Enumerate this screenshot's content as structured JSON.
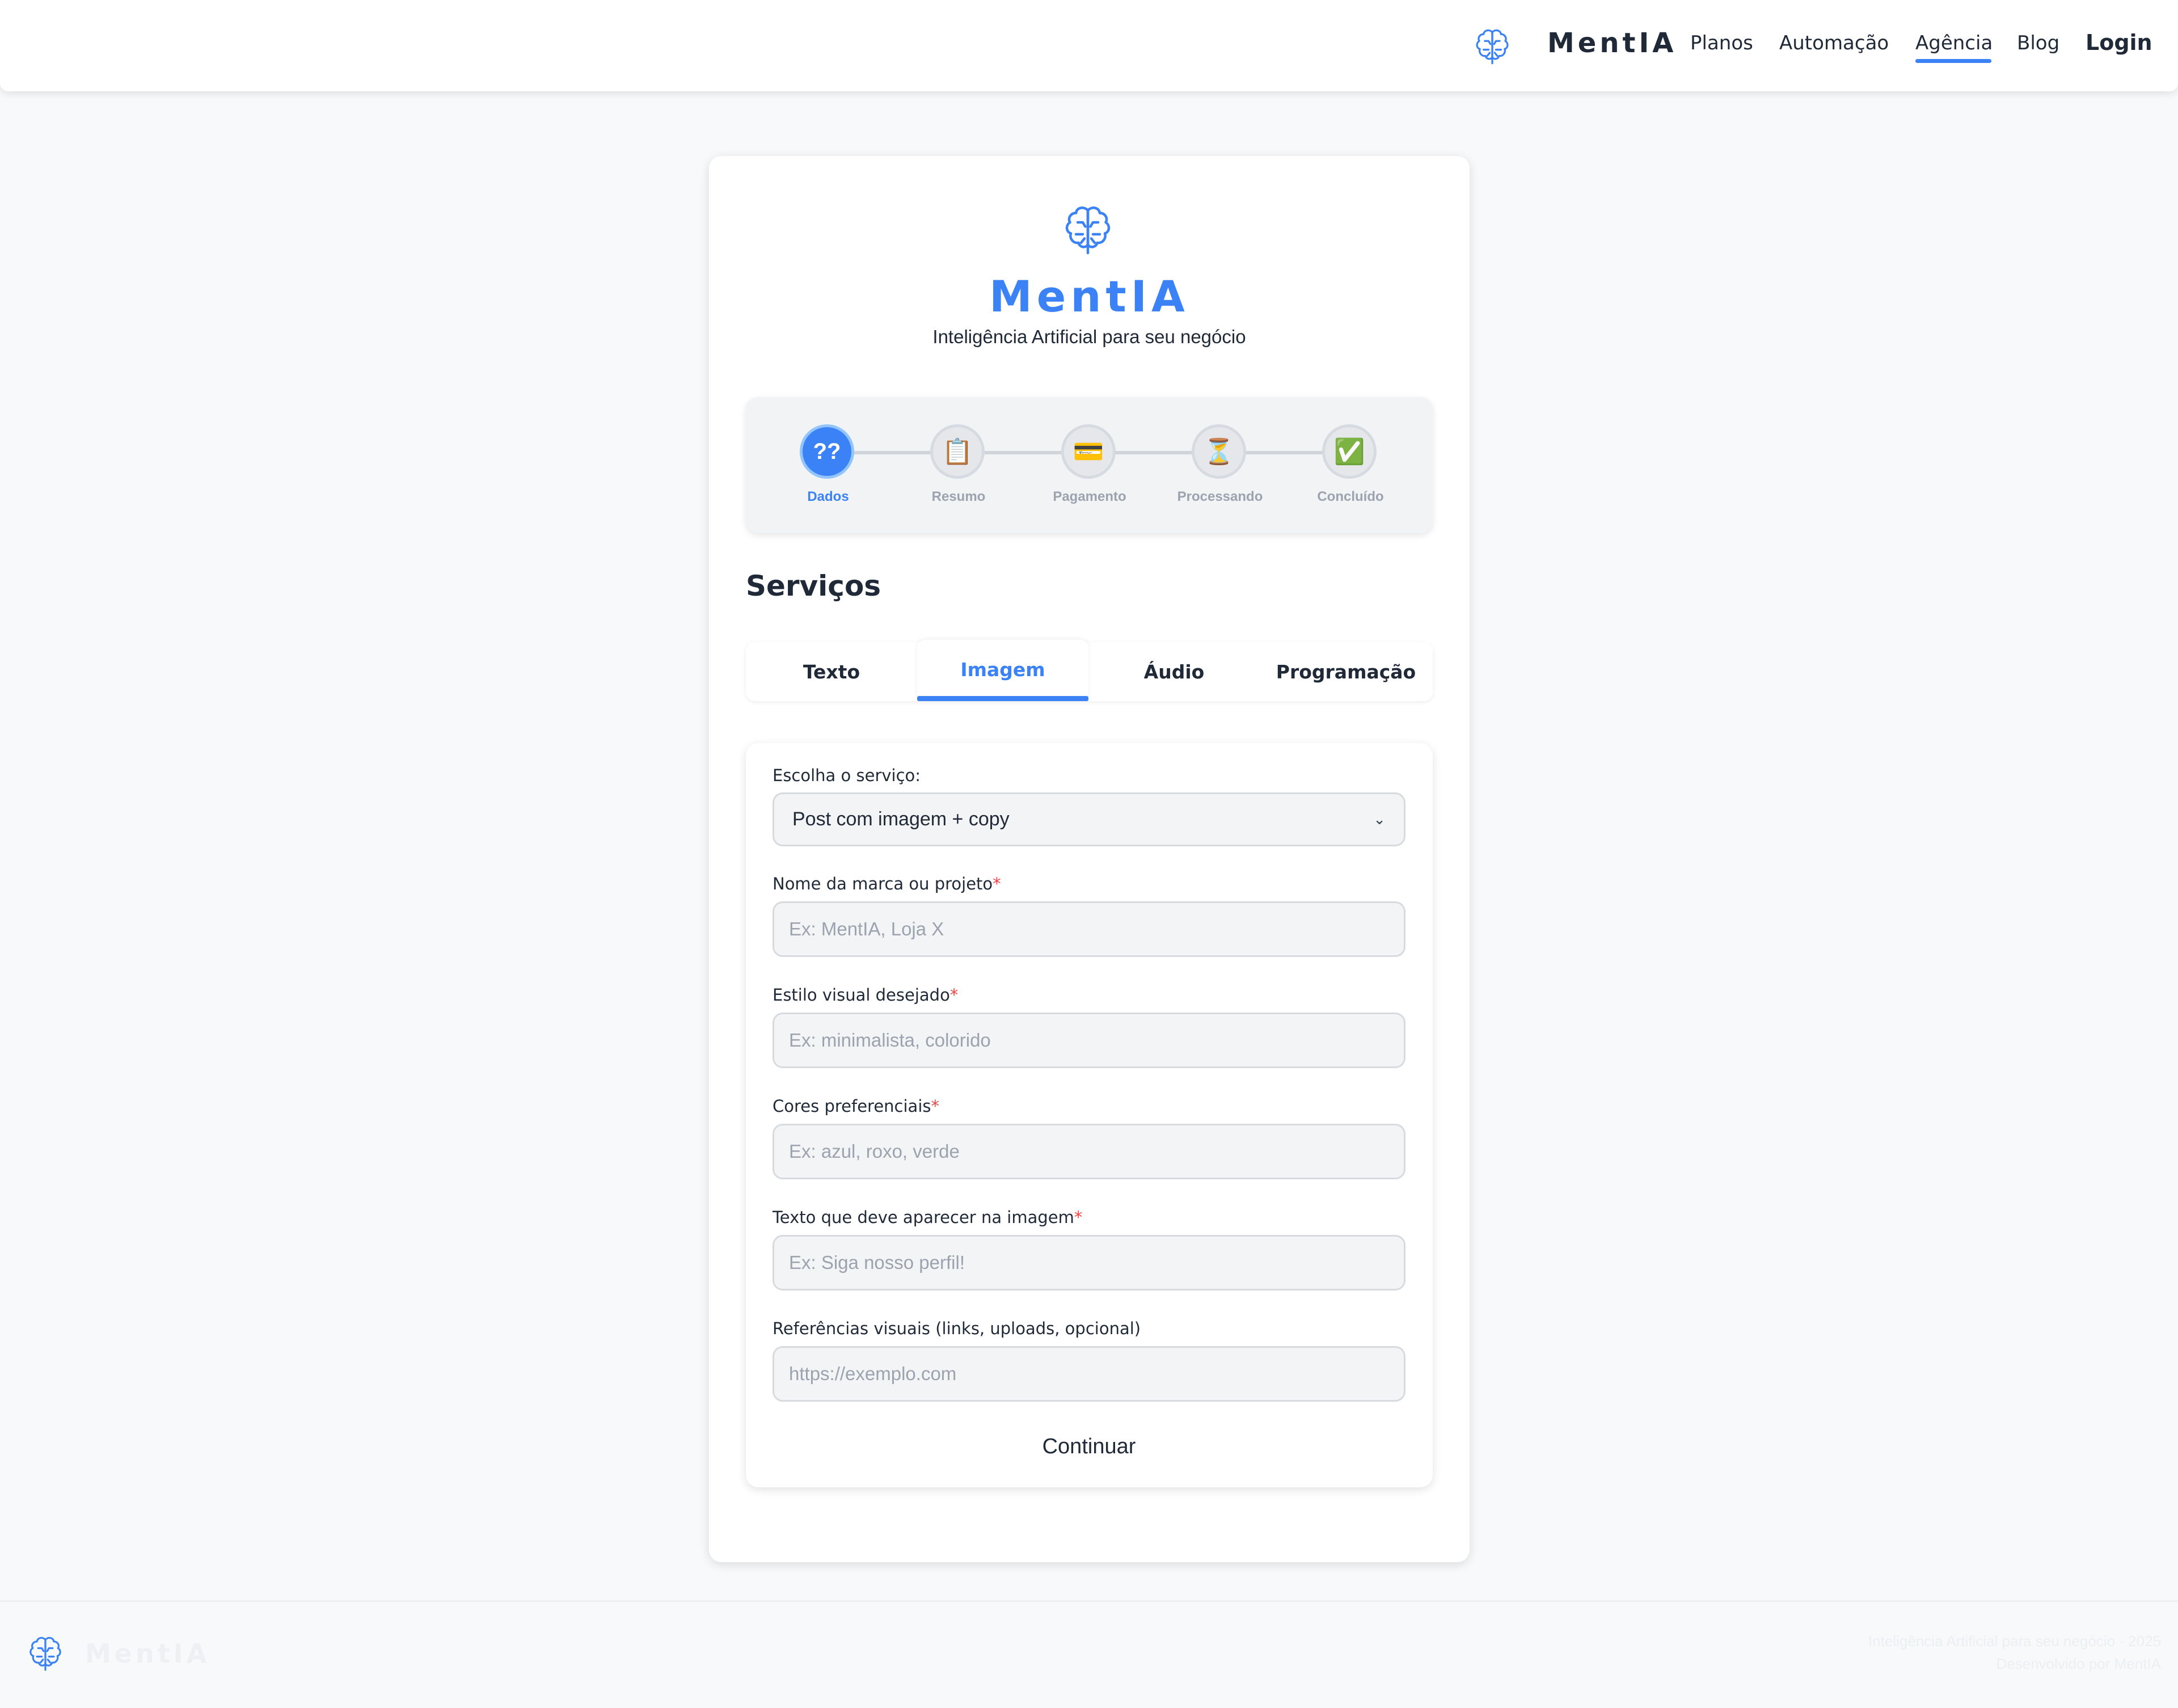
{
  "brand": {
    "name": "MentIA",
    "tagline": "Inteligência Artificial para seu negócio",
    "accent_color": "#3b82f6"
  },
  "nav": {
    "links": [
      {
        "label": "Planos"
      },
      {
        "label": "Automação"
      },
      {
        "label": "Agência",
        "active": true
      },
      {
        "label": "Blog"
      }
    ],
    "login_label": "Login"
  },
  "stepper": {
    "steps": [
      {
        "label": "Dados",
        "icon": "question-icon",
        "glyph": "?⃟?",
        "active": true
      },
      {
        "label": "Resumo",
        "icon": "clipboard-icon",
        "glyph": "📋"
      },
      {
        "label": "Pagamento",
        "icon": "credit-card-icon",
        "glyph": "💳"
      },
      {
        "label": "Processando",
        "icon": "hourglass-icon",
        "glyph": "⏳"
      },
      {
        "label": "Concluído",
        "icon": "check-icon",
        "glyph": "✅"
      }
    ]
  },
  "section": {
    "title": "Serviços"
  },
  "tabs": [
    {
      "label": "Texto"
    },
    {
      "label": "Imagem",
      "active": true
    },
    {
      "label": "Áudio"
    },
    {
      "label": "Programação"
    }
  ],
  "form": {
    "service_label": "Escolha o serviço:",
    "service_selected": "Post com imagem + copy",
    "fields": [
      {
        "label": "Nome da marca ou projeto",
        "required": "*",
        "placeholder": "Ex: MentIA, Loja X"
      },
      {
        "label": "Estilo visual desejado",
        "required": "*",
        "placeholder": "Ex: minimalista, colorido"
      },
      {
        "label": "Cores preferenciais",
        "required": "*",
        "placeholder": "Ex: azul, roxo, verde"
      },
      {
        "label": "Texto que deve aparecer na imagem",
        "required": "*",
        "placeholder": "Ex: Siga nosso perfil!"
      },
      {
        "label": "Referências visuais (links, uploads, opcional)",
        "required": "",
        "placeholder": "https://exemplo.com"
      }
    ],
    "submit_label": "Continuar"
  },
  "footer": {
    "brand": "MentIA",
    "line1": "Inteligência Artificial para seu negócio · 2025",
    "line2": "Desenvolvido por MentIA"
  }
}
